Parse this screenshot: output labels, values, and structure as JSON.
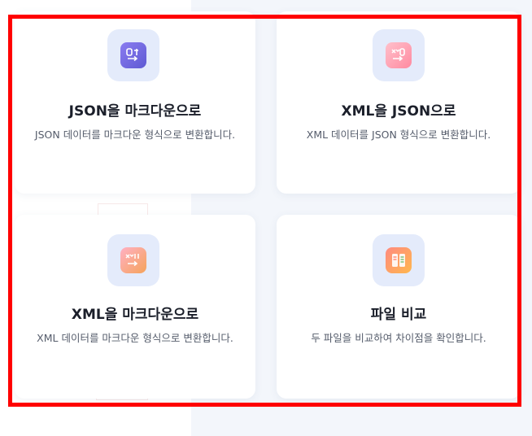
{
  "cards": [
    {
      "title": "JSON을 마크다운으로",
      "desc": "JSON 데이터를 마크다운 형식으로 변환합니다.",
      "icon": "json-to-markdown-icon"
    },
    {
      "title": "XML을 JSON으로",
      "desc": "XML 데이터를 JSON 형식으로 변환합니다.",
      "icon": "xml-to-json-icon"
    },
    {
      "title": "XML을 마크다운으로",
      "desc": "XML 데이터를 마크다운 형식으로 변환합니다.",
      "icon": "xml-to-markdown-icon"
    },
    {
      "title": "파일 비교",
      "desc": "두 파일을 비교하여 차이점을 확인합니다.",
      "icon": "file-compare-icon"
    }
  ],
  "colors": {
    "highlight": "#ff0000",
    "icon_bg": "#e4ebfb",
    "icon_purple": "#7a6ee0",
    "icon_pink": "#ff9fb1",
    "icon_orange": "#f5a35a"
  }
}
